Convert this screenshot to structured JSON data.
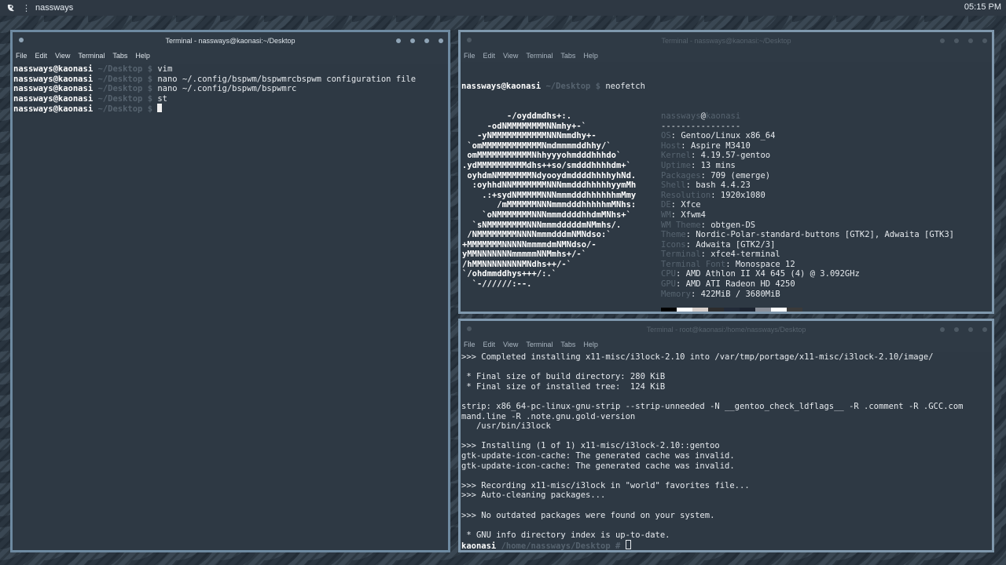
{
  "topbar": {
    "logo_icon": "distro-logo-icon",
    "workspace": "nassways",
    "clock": "05:15 PM"
  },
  "win_left": {
    "title": "Terminal - nassways@kaonasi:~/Desktop",
    "menu": [
      "File",
      "Edit",
      "View",
      "Terminal",
      "Tabs",
      "Help"
    ],
    "lines": [
      {
        "user": "nassways@kaonasi",
        "path": " ~/Desktop $ ",
        "cmd": "vim"
      },
      {
        "user": "nassways@kaonasi",
        "path": " ~/Desktop $ ",
        "cmd": "nano ~/.config/bspwm/bspwmrcbspwm configuration file"
      },
      {
        "user": "nassways@kaonasi",
        "path": " ~/Desktop $ ",
        "cmd": "nano ~/.config/bspwm/bspwmrc"
      },
      {
        "user": "nassways@kaonasi",
        "path": " ~/Desktop $ ",
        "cmd": "st"
      },
      {
        "user": "nassways@kaonasi",
        "path": " ~/Desktop $ ",
        "cmd": ""
      }
    ]
  },
  "win_top_right": {
    "title": "Terminal - nassways@kaonasi:~/Desktop",
    "menu": [
      "File",
      "Edit",
      "View",
      "Terminal",
      "Tabs",
      "Help"
    ],
    "prompt_user": "nassways@kaonasi",
    "prompt_path": " ~/Desktop $ ",
    "command": "neofetch",
    "logo_lines": [
      "         -/oyddmdhs+:.",
      "     -odNMMMMMMMMNNmhy+-`",
      "   -yNMMMMMMMMMMMNNNmmdhy+-",
      " `omMMMMMMMMMMMMNmdmmmmddhhy/`",
      " omMMMMMMMMMMMNhhyyyohmdddhhhdo`",
      ".ydMMMMMMMMMMdhs++so/smdddhhhhdm+`",
      " oyhdmNMMMMMMMNdyooydmddddhhhhyhNd.",
      "  :oyhhdNNMMMMMMMNNNmmdddhhhhhyymMh",
      "    .:+sydNMMMMMNNNmmmdddhhhhhhmMmy",
      "       /mMMMMMMNNNmmmdddhhhhhmMNhs:",
      "    `oNMMMMMMMNNNmmmddddhhdmMNhs+`",
      "  `sNMMMMMMMMNNNmmmdddddmNMmhs/.",
      " /NMMMMMMMMNNNNmmmdddmNMNdso:`",
      "+MMMMMMMNNNNNmmmmdmNMNdso/-",
      "yMMNNNNNNNmmmmmNNMmhs+/-`",
      "/hMMNNNNNNNNMNdhs++/-`",
      "`/ohdmmddhys+++/:.`",
      "  `-//////:--."
    ],
    "info_header": {
      "user": "nassways",
      "at": "@",
      "host": "kaonasi",
      "sep": "----------------"
    },
    "info": [
      {
        "k": "OS",
        "v": "Gentoo/Linux x86_64"
      },
      {
        "k": "Host",
        "v": "Aspire M3410"
      },
      {
        "k": "Kernel",
        "v": "4.19.57-gentoo"
      },
      {
        "k": "Uptime",
        "v": "13 mins"
      },
      {
        "k": "Packages",
        "v": "709 (emerge)"
      },
      {
        "k": "Shell",
        "v": "bash 4.4.23"
      },
      {
        "k": "Resolution",
        "v": "1920x1080"
      },
      {
        "k": "DE",
        "v": "Xfce"
      },
      {
        "k": "WM",
        "v": "Xfwm4"
      },
      {
        "k": "WM Theme",
        "v": "obtgen-DS"
      },
      {
        "k": "Theme",
        "v": "Nordic-Polar-standard-buttons [GTK2], Adwaita [GTK3]"
      },
      {
        "k": "Icons",
        "v": "Adwaita [GTK2/3]"
      },
      {
        "k": "Terminal",
        "v": "xfce4-terminal"
      },
      {
        "k": "Terminal Font",
        "v": "Monospace 12"
      },
      {
        "k": "CPU",
        "v": "AMD Athlon II X4 645 (4) @ 3.092GHz"
      },
      {
        "k": "GPU",
        "v": "AMD ATI Radeon HD 4250"
      },
      {
        "k": "Memory",
        "v": "422MiB / 3680MiB"
      }
    ],
    "swatch_colors": [
      "#000000",
      "#ffffff",
      "#d8d0cc",
      "#2c2c2c",
      "#222a38",
      "#1c2330",
      "#8a8f99",
      "#ffffff",
      "#3a3a3a"
    ]
  },
  "win_bottom_right": {
    "title": "Terminal - root@kaonasi:/home/nassways/Desktop",
    "menu": [
      "File",
      "Edit",
      "View",
      "Terminal",
      "Tabs",
      "Help"
    ],
    "lines": [
      ">>> Completed installing x11-misc/i3lock-2.10 into /var/tmp/portage/x11-misc/i3lock-2.10/image/",
      "",
      " * Final size of build directory: 280 KiB",
      " * Final size of installed tree:  124 KiB",
      "",
      "strip: x86_64-pc-linux-gnu-strip --strip-unneeded -N __gentoo_check_ldflags__ -R .comment -R .GCC.com",
      "mand.line -R .note.gnu.gold-version",
      "   /usr/bin/i3lock",
      "",
      ">>> Installing (1 of 1) x11-misc/i3lock-2.10::gentoo",
      "gtk-update-icon-cache: The generated cache was invalid.",
      "gtk-update-icon-cache: The generated cache was invalid.",
      "",
      ">>> Recording x11-misc/i3lock in \"world\" favorites file...",
      ">>> Auto-cleaning packages...",
      "",
      ">>> No outdated packages were found on your system.",
      "",
      " * GNU info directory index is up-to-date."
    ],
    "prompt_user": "kaonasi",
    "prompt_path": " /home/nassways/Desktop # "
  }
}
